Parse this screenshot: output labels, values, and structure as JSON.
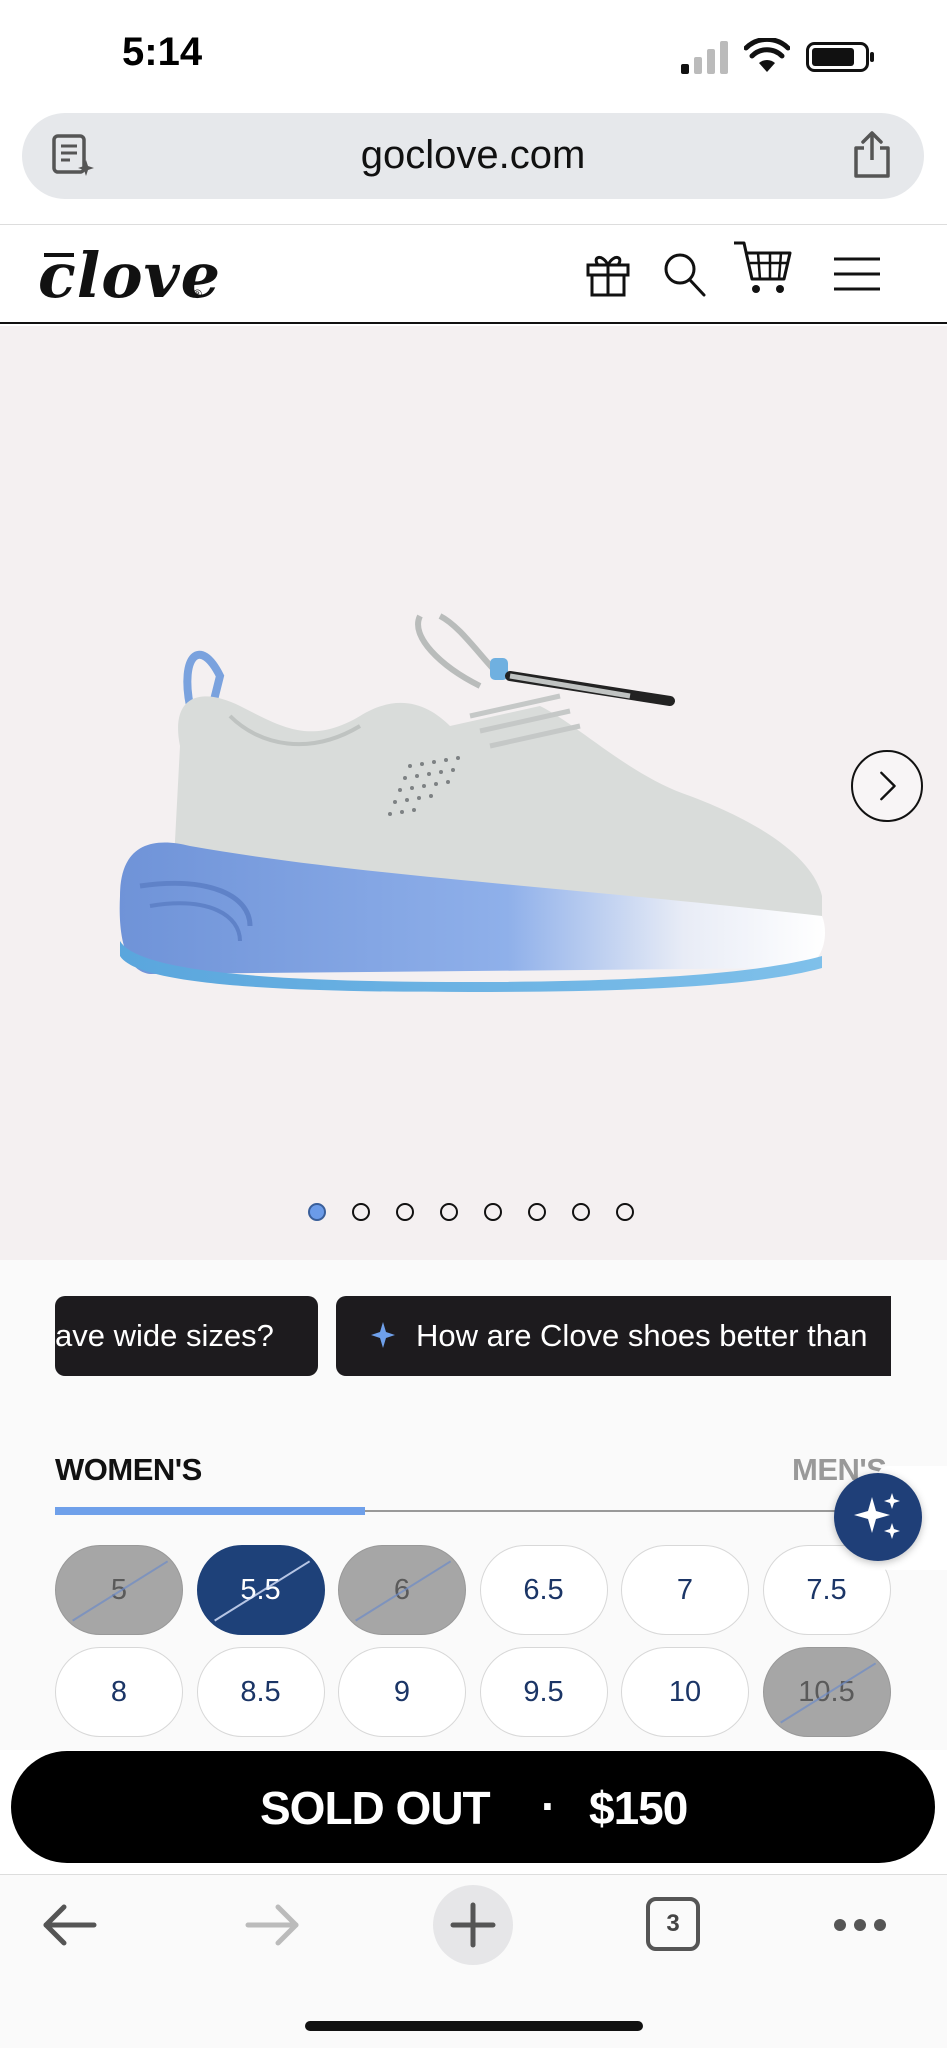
{
  "status_bar": {
    "time": "5:14"
  },
  "browser": {
    "url": "goclove.com",
    "tab_count": "3"
  },
  "site": {
    "logo": "clove",
    "logo_mark": "®"
  },
  "hero": {
    "image_count": 8,
    "active_image": 1
  },
  "questions": [
    {
      "label": "ave wide sizes?"
    },
    {
      "label": "How are Clove shoes better than"
    }
  ],
  "size_tabs": {
    "women": "WOMEN'S",
    "men": "MEN'S"
  },
  "sizes": [
    {
      "label": "5",
      "state": "out_of_stock"
    },
    {
      "label": "5.5",
      "state": "selected_out_of_stock"
    },
    {
      "label": "6",
      "state": "out_of_stock"
    },
    {
      "label": "6.5",
      "state": "available"
    },
    {
      "label": "7",
      "state": "available"
    },
    {
      "label": "7.5",
      "state": "available"
    },
    {
      "label": "8",
      "state": "available"
    },
    {
      "label": "8.5",
      "state": "available"
    },
    {
      "label": "9",
      "state": "available"
    },
    {
      "label": "9.5",
      "state": "available"
    },
    {
      "label": "10",
      "state": "available"
    },
    {
      "label": "10.5",
      "state": "out_of_stock"
    }
  ],
  "buy": {
    "label": "SOLD OUT",
    "separator": "·",
    "price": "$150"
  },
  "colors": {
    "accent": "#6fa0ea",
    "navy": "#1e4179",
    "sole_blue": "#7ea2e0"
  }
}
